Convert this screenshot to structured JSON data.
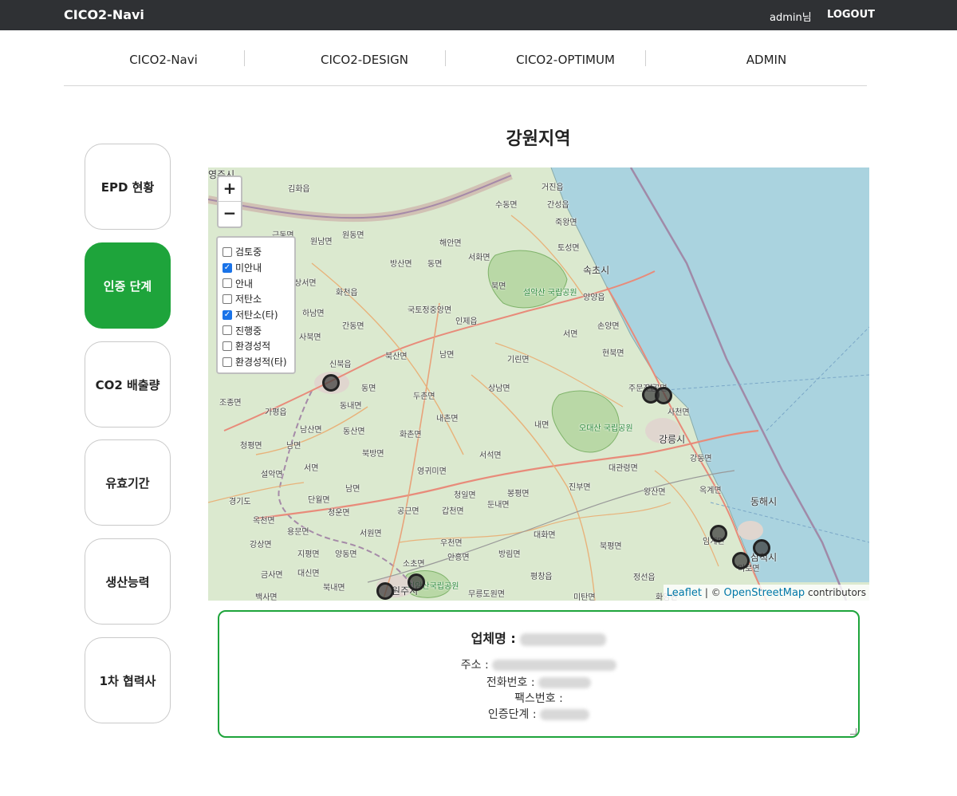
{
  "topbar": {
    "brand": "CICO2-Navi",
    "user": "admin님",
    "logout": "LOGOUT"
  },
  "nav": {
    "items": [
      "CICO2-Navi",
      "CICO2-DESIGN",
      "CICO2-OPTIMUM",
      "ADMIN"
    ]
  },
  "page_title": "강원지역",
  "sidebar": {
    "items": [
      {
        "label": "EPD 현황",
        "active": false
      },
      {
        "label": "인증 단계",
        "active": true
      },
      {
        "label": "CO2 배출량",
        "active": false
      },
      {
        "label": "유효기간",
        "active": false
      },
      {
        "label": "생산능력",
        "active": false
      },
      {
        "label": "1차 협력사",
        "active": false
      }
    ]
  },
  "map": {
    "zoom_in": "+",
    "zoom_out": "−",
    "layers": [
      {
        "label": "검토중",
        "checked": false
      },
      {
        "label": "미안내",
        "checked": true
      },
      {
        "label": "안내",
        "checked": false
      },
      {
        "label": "저탄소",
        "checked": false
      },
      {
        "label": "저탄소(타)",
        "checked": true
      },
      {
        "label": "진행중",
        "checked": false
      },
      {
        "label": "환경성적",
        "checked": false
      },
      {
        "label": "환경성적(타)",
        "checked": false
      }
    ],
    "attribution": {
      "leaflet": "Leaflet",
      "sep": " | © ",
      "osm": "OpenStreetMap",
      "contributors": " contributors"
    },
    "place_labels": [
      "김화읍",
      "거진읍",
      "수동면",
      "간성읍",
      "죽왕면",
      "토성면",
      "속초시",
      "근동면",
      "원남면",
      "원동면",
      "해안면",
      "방산면",
      "동면",
      "서화면",
      "상서면",
      "화천읍",
      "국토정중앙면",
      "인제읍",
      "북면",
      "설악산 국립공원",
      "양양읍",
      "하남면",
      "간동면",
      "서면",
      "손양면",
      "사북면",
      "신북읍",
      "북산면",
      "남면",
      "기린면",
      "현북면",
      "주문진읍",
      "동면",
      "두촌면",
      "상남면",
      "연곡면",
      "조종면",
      "가평읍",
      "동내면",
      "내촌면",
      "내면",
      "사천면",
      "오대산 국립공원",
      "남산면",
      "동산면",
      "화촌면",
      "강릉시",
      "청평면",
      "남면",
      "북방면",
      "서석면",
      "강동면",
      "설악면",
      "서면",
      "영귀미면",
      "대관령면",
      "진부면",
      "왕산면",
      "옥계면",
      "경기도",
      "단월면",
      "남면",
      "청일면",
      "봉평면",
      "동해시",
      "옥천면",
      "청운면",
      "공근면",
      "갑천면",
      "둔내면",
      "대화면",
      "임계면",
      "삼척시",
      "강상면",
      "용문면",
      "서원면",
      "우천면",
      "방림면",
      "북평면",
      "지평면",
      "양동면",
      "소초면",
      "안흥면",
      "미로면",
      "금사면",
      "대신면",
      "북내면",
      "치악산국립공원",
      "무릉도원면",
      "평창읍",
      "미탄면",
      "정선읍",
      "화암면",
      "백사면",
      "원주시",
      "영주시"
    ],
    "markers": [
      {
        "name": "marker-1"
      },
      {
        "name": "marker-2"
      },
      {
        "name": "marker-3"
      },
      {
        "name": "marker-4"
      },
      {
        "name": "marker-5"
      },
      {
        "name": "marker-6"
      },
      {
        "name": "marker-7"
      },
      {
        "name": "marker-8"
      }
    ]
  },
  "info": {
    "company_label": "업체명 :",
    "address_label": "주소 :",
    "phone_label": "전화번호 :",
    "fax_label": "팩스번호 :",
    "stage_label": "인증단계 :"
  }
}
